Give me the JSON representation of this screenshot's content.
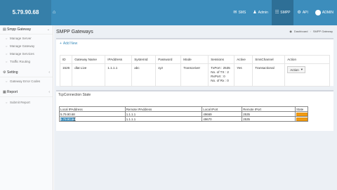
{
  "app": {
    "brand": "5.79.90.68"
  },
  "topnav": {
    "items": [
      {
        "label": "SMS",
        "icon": "sms-icon",
        "glyph": "✉"
      },
      {
        "label": "Admin",
        "icon": "user-icon",
        "glyph": "♟"
      },
      {
        "label": "SMPP",
        "icon": "grid-icon",
        "glyph": "☷"
      },
      {
        "label": "API",
        "icon": "api-icon",
        "glyph": "⚙"
      },
      {
        "label": "ADMIN",
        "icon": "avatar",
        "glyph": ""
      }
    ]
  },
  "sidebar": {
    "sections": [
      {
        "label": "Smpp Gateway",
        "items": [
          "Manage Server",
          "Manage Gateway",
          "Manage Services",
          "Traffic Routing"
        ]
      },
      {
        "label": "Setting",
        "items": [
          "Gateway Error Codes"
        ]
      },
      {
        "label": "Report",
        "items": [
          "Submit Report"
        ]
      }
    ]
  },
  "page": {
    "title": "SMPP Gateways",
    "breadcrumb": [
      "Dashboard",
      "SMPP Gateway"
    ]
  },
  "gateways": {
    "add_label": "Add New",
    "columns": [
      "ID",
      "Gateway Name",
      "IPAddress",
      "SystemId",
      "Password",
      "Mode",
      "Sessions",
      "Active",
      "SmsChannel",
      "Action"
    ],
    "rows": [
      {
        "id": "1526",
        "name": "dlat Live",
        "ip": "1.1.1.1",
        "system_id": "abc",
        "password": "xyz",
        "mode": "Transceiver",
        "sessions": [
          "TxPort : 2535",
          "No. of TX : 2",
          "RxPort : 0",
          "No. of Rx : 0"
        ],
        "active": "Yes",
        "channel": "Transactional",
        "action": "Action"
      }
    ]
  },
  "connections": {
    "title": "TcpConnection State",
    "columns": [
      "Local IPAddress",
      "Remote IPAddress",
      "Local IPort",
      "Remote IPort",
      "State"
    ],
    "rows": [
      {
        "local_ip": "5.79.90.68",
        "remote_ip": "1.1.1.1",
        "local_port": "49669",
        "remote_port": "2535",
        "state_color": "#f39c12"
      },
      {
        "local_ip": "5.79.90.68",
        "remote_ip": "1.1.1.1",
        "local_port": "49670",
        "remote_port": "2535",
        "state_color": "#f39c12"
      }
    ]
  }
}
